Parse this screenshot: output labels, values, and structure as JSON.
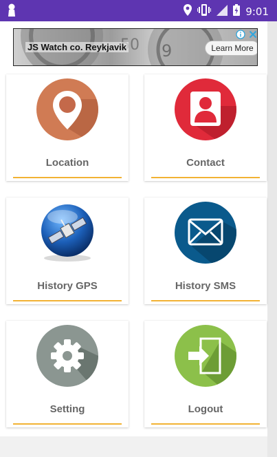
{
  "status_bar": {
    "time": "9:01",
    "color": "#5e35b1",
    "icons": [
      "keyhole-icon",
      "location-pin-icon",
      "vibrate-icon",
      "signal-icon",
      "battery-charging-icon"
    ]
  },
  "ad": {
    "title": "JS Watch co. Reykjavik",
    "cta": "Learn More",
    "icons": [
      "adchoices-info-icon",
      "close-icon"
    ]
  },
  "menu": {
    "accent": "#f2b233",
    "items": [
      {
        "label": "Location",
        "icon": "location-pin-icon",
        "color": "#d07b54"
      },
      {
        "label": "Contact",
        "icon": "contact-person-icon",
        "color": "#e02a3a"
      },
      {
        "label": "History GPS",
        "icon": "satellite-icon",
        "color": "#1c5fb8"
      },
      {
        "label": "History SMS",
        "icon": "envelope-icon",
        "color": "#0a5a8c"
      },
      {
        "label": "Setting",
        "icon": "gear-icon",
        "color": "#8b9691"
      },
      {
        "label": "Logout",
        "icon": "logout-icon",
        "color": "#8cc04a"
      }
    ]
  }
}
